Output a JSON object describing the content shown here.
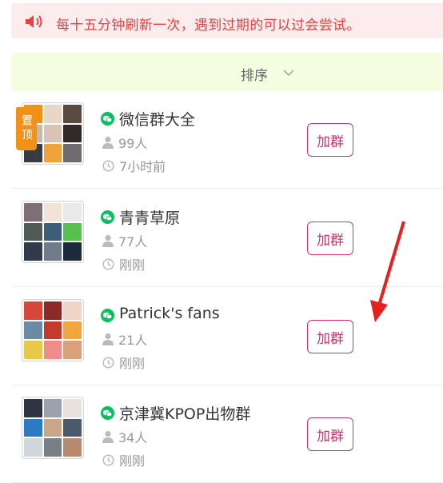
{
  "notice": {
    "text": "每十五分钟刷新一次，遇到过期的可以过会尝试。",
    "icon": "speaker-icon",
    "color": "#e8423f"
  },
  "sort": {
    "label": "排序",
    "icon": "chevron-down-icon"
  },
  "colors": {
    "join_border": "#d7326a",
    "pin_bg": "#f39017",
    "wechat_green": "#07c160"
  },
  "groups": [
    {
      "name": "微信群大全",
      "members": "99人",
      "time": "7小时前",
      "join_label": "加群",
      "pinned": true,
      "pin_label": "置顶",
      "avatar_colors": [
        "#f39017",
        "#e9d6c8",
        "#5b4a3f",
        "#c9b8aa",
        "#d8c3b4",
        "#2f2a28",
        "#3a3a45",
        "#f2a23a",
        "#6e6a70"
      ]
    },
    {
      "name": "青青草原",
      "members": "77人",
      "time": "刚刚",
      "join_label": "加群",
      "pinned": false,
      "avatar_colors": [
        "#7d6f73",
        "#f1e4d6",
        "#e9e9e9",
        "#4f5b54",
        "#3d5e7a",
        "#56c04c",
        "#2f3a4a",
        "#6e7c8a",
        "#1e2a3e"
      ]
    },
    {
      "name": "Patrick's fans",
      "members": "21人",
      "time": "刚刚",
      "join_label": "加群",
      "pinned": false,
      "avatar_colors": [
        "#d6463a",
        "#8c2a2a",
        "#f0d4c8",
        "#6b8aa6",
        "#c43a2c",
        "#f4a63c",
        "#e8c84a",
        "#f08c8c",
        "#d9a07a"
      ]
    },
    {
      "name": "京津冀KPOP出物群",
      "members": "34人",
      "time": "刚刚",
      "join_label": "加群",
      "pinned": false,
      "avatar_colors": [
        "#2f3440",
        "#9aa3ad",
        "#e8e2dc",
        "#2c7ac4",
        "#c9a58a",
        "#4a5a6a",
        "#cfd6dc",
        "#7a7e86",
        "#b58a6e"
      ]
    }
  ]
}
